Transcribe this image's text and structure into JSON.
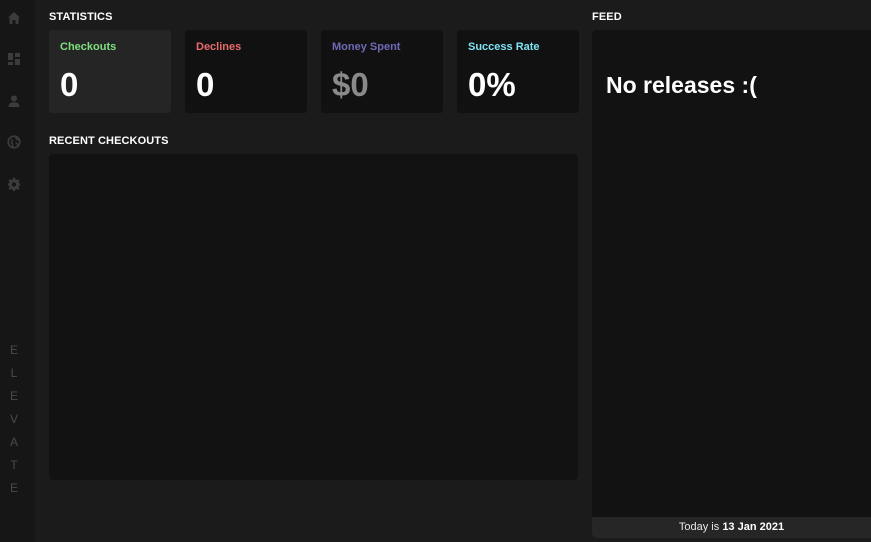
{
  "sidebar": {
    "nav": [
      {
        "icon": "home-icon"
      },
      {
        "icon": "dashboard-icon"
      },
      {
        "icon": "user-icon"
      },
      {
        "icon": "globe-icon"
      },
      {
        "icon": "gear-icon"
      }
    ],
    "brand_letters": [
      "E",
      "L",
      "E",
      "V",
      "A",
      "T",
      "E"
    ]
  },
  "statistics": {
    "title": "STATISTICS",
    "cards": [
      {
        "label": "Checkouts",
        "value": "0",
        "label_color": "#7de07d",
        "value_color": "#ffffff"
      },
      {
        "label": "Declines",
        "value": "0",
        "label_color": "#e96b6b",
        "value_color": "#ffffff"
      },
      {
        "label": "Money Spent",
        "value": "$0",
        "label_color": "#6f6ab8",
        "value_color": "#8a8a8a"
      },
      {
        "label": "Success Rate",
        "value": "0%",
        "label_color": "#7fe3f2",
        "value_color": "#ffffff"
      }
    ]
  },
  "recent_checkouts": {
    "title": "RECENT CHECKOUTS"
  },
  "feed": {
    "title": "FEED",
    "empty_text": "No releases :(",
    "footer_prefix": "Today is",
    "footer_date": "13 Jan 2021"
  },
  "colors": {
    "background": "#1b1b1b",
    "sidebar": "#161616",
    "panel": "#121212",
    "icon": "#3c3c3c"
  }
}
